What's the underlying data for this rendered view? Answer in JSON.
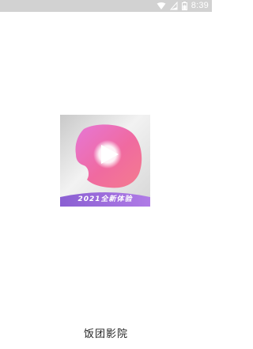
{
  "status_bar": {
    "time": "8:39",
    "icons": [
      "wifi-icon",
      "signal-icon",
      "battery-icon"
    ]
  },
  "splash": {
    "logo_icon": "play-bubble-logo",
    "banner_text": "2021全新体验"
  },
  "app": {
    "name": "饭团影院"
  },
  "colors": {
    "status_bar": "#d2d2d2",
    "logo_pink": "#f06aa0",
    "banner_purple": "#9b6ad6"
  }
}
